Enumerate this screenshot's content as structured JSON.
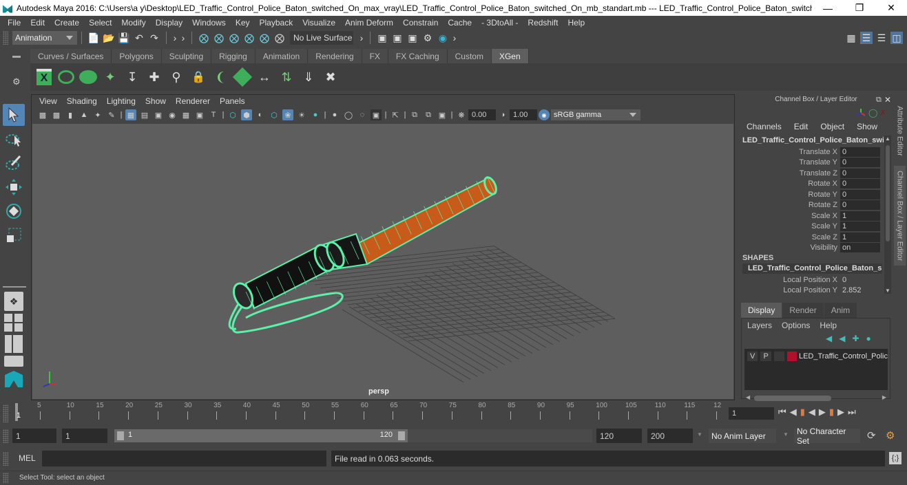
{
  "window": {
    "title": "Autodesk Maya 2016: C:\\Users\\a y\\Desktop\\LED_Traffic_Control_Police_Baton_switched_On_max_vray\\LED_Traffic_Control_Police_Baton_switched_On_mb_standart.mb   ---   LED_Traffic_Control_Police_Baton_switched_On_ncl...",
    "minimize": "—",
    "maximize": "❐",
    "close": "✕"
  },
  "menubar": [
    "File",
    "Edit",
    "Create",
    "Select",
    "Modify",
    "Display",
    "Windows",
    "Key",
    "Playback",
    "Visualize",
    "Anim Deform",
    "Constrain",
    "Cache",
    "- 3DtoAll -",
    "Redshift",
    "Help"
  ],
  "statusline": {
    "mode": "Animation",
    "live_surface": "No Live Surface"
  },
  "shelf": {
    "tabs": [
      "Curves / Surfaces",
      "Polygons",
      "Sculpting",
      "Rigging",
      "Animation",
      "Rendering",
      "FX",
      "FX Caching",
      "Custom",
      "XGen"
    ],
    "active_tab": "XGen"
  },
  "panel": {
    "menu": [
      "View",
      "Shading",
      "Lighting",
      "Show",
      "Renderer",
      "Panels"
    ],
    "exposure": "0.00",
    "gamma": "1.00",
    "colorspace": "sRGB gamma",
    "camera": "persp"
  },
  "channelbox": {
    "title": "Channel Box / Layer Editor",
    "menu": [
      "Channels",
      "Edit",
      "Object",
      "Show"
    ],
    "object": "LED_Traffic_Control_Police_Baton_swi...",
    "channels": [
      {
        "label": "Translate X",
        "value": "0"
      },
      {
        "label": "Translate Y",
        "value": "0"
      },
      {
        "label": "Translate Z",
        "value": "0"
      },
      {
        "label": "Rotate X",
        "value": "0"
      },
      {
        "label": "Rotate Y",
        "value": "0"
      },
      {
        "label": "Rotate Z",
        "value": "0"
      },
      {
        "label": "Scale X",
        "value": "1"
      },
      {
        "label": "Scale Y",
        "value": "1"
      },
      {
        "label": "Scale Z",
        "value": "1"
      },
      {
        "label": "Visibility",
        "value": "on"
      }
    ],
    "shapes_header": "SHAPES",
    "shape_name": "LED_Traffic_Control_Police_Baton_s...",
    "shape_channels": [
      {
        "label": "Local Position X",
        "value": "0"
      },
      {
        "label": "Local Position Y",
        "value": "2.852"
      }
    ]
  },
  "sidetabs": [
    "Attribute Editor",
    "Channel Box / Layer Editor"
  ],
  "layereditor": {
    "tabs": [
      "Display",
      "Render",
      "Anim"
    ],
    "active_tab": "Display",
    "menu": [
      "Layers",
      "Options",
      "Help"
    ],
    "layer": {
      "v": "V",
      "p": "P",
      "name": "LED_Traffic_Control_Polic",
      "color": "#b0102a"
    }
  },
  "timeline": {
    "ticks": [
      "5",
      "10",
      "15",
      "20",
      "25",
      "30",
      "35",
      "40",
      "45",
      "50",
      "55",
      "60",
      "65",
      "70",
      "75",
      "80",
      "85",
      "90",
      "95",
      "100",
      "105",
      "110",
      "115",
      "12"
    ],
    "current": "1",
    "current_frame_field": "1"
  },
  "range": {
    "start": "1",
    "anim_start": "1",
    "slider_start": "1",
    "slider_end": "120",
    "end": "120",
    "anim_end": "200",
    "anim_layer": "No Anim Layer",
    "character_set": "No Character Set"
  },
  "cmdline": {
    "lang": "MEL",
    "input": "",
    "result": "File read in  0.063 seconds."
  },
  "helpline": "Select Tool: select an object",
  "colors": {
    "wire_green": "#5cf0a8",
    "baton_orange": "#d2601e",
    "selected_blue": "#5285b8",
    "playhead_orange": "#e07a3a"
  }
}
